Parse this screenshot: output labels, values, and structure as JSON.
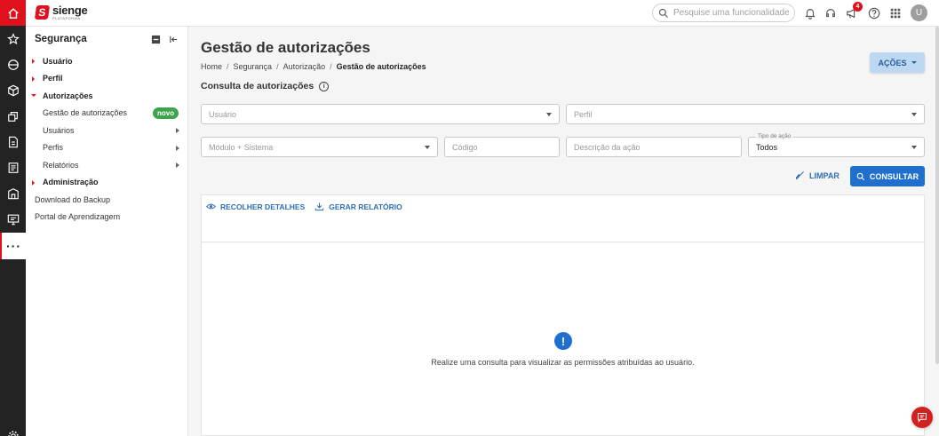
{
  "rail": {
    "items": [
      {
        "icon": "home-icon"
      },
      {
        "icon": "star-icon"
      },
      {
        "icon": "globe-icon"
      },
      {
        "icon": "cube-icon"
      },
      {
        "icon": "stack-icon"
      },
      {
        "icon": "document-icon"
      },
      {
        "icon": "list-doc-icon"
      },
      {
        "icon": "building-icon"
      },
      {
        "icon": "monitor-icon"
      },
      {
        "icon": "more-icon"
      },
      {
        "icon": "gear-icon"
      }
    ],
    "more_label": "···"
  },
  "header": {
    "brand_name": "sienge",
    "brand_sub": "PLATAFORMA",
    "search_placeholder": "Pesquise uma funcionalidade.",
    "notifications_badge": "4",
    "avatar_initial": "U"
  },
  "sidebar": {
    "title": "Segurança",
    "items": [
      {
        "label": "Usuário"
      },
      {
        "label": "Perfil"
      },
      {
        "label": "Autorizações"
      },
      {
        "label": "Gestão de autorizações",
        "badge": "novo"
      },
      {
        "label": "Usuários"
      },
      {
        "label": "Perfis"
      },
      {
        "label": "Relatórios"
      },
      {
        "label": "Administração"
      },
      {
        "label": "Download do Backup"
      },
      {
        "label": "Portal de Aprendizagem"
      }
    ]
  },
  "main": {
    "title": "Gestão de autorizações",
    "breadcrumb": [
      "Home",
      "Segurança",
      "Autorização",
      "Gestão de autorizações"
    ],
    "breadcrumb_sep": "/",
    "actions_label": "AÇÕES",
    "section_title": "Consulta de autorizações",
    "filters": {
      "usuario_placeholder": "Usuário",
      "perfil_placeholder": "Perfil",
      "modulo_placeholder": "Módulo + Sistema",
      "codigo_placeholder": "Código",
      "descricao_placeholder": "Descrição da ação",
      "tipo_acao_label": "Tipo de ação",
      "tipo_acao_value": "Todos"
    },
    "clear_label": "LIMPAR",
    "search_label": "CONSULTAR",
    "panel": {
      "collapse_label": "RECOLHER DETALHES",
      "report_label": "GERAR RELATÓRIO",
      "empty_icon": "!",
      "empty_text": "Realize uma consulta para visualizar as permissões atribuídas ao usuário."
    }
  },
  "colors": {
    "brand_red": "#e0101c",
    "primary_blue": "#1f6fcf",
    "badge_green": "#3fa34d",
    "actions_bg": "#bcd8f3"
  }
}
